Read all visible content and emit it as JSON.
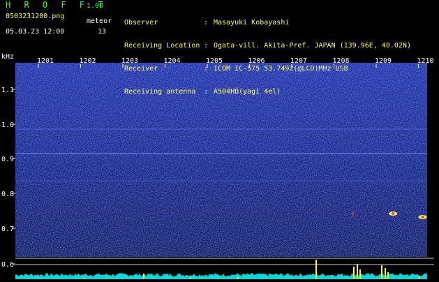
{
  "header": {
    "app_title": "H R O F F T",
    "app_version": "1.00",
    "file_name": "0503231200.png",
    "date_time": "05.03.23 12:00",
    "counter_label": "meteor",
    "counter_value": "13"
  },
  "station_info": [
    {
      "key": "Observer",
      "value": "Masayuki Kobayashi"
    },
    {
      "key": "Receiving Location",
      "value": "Ogata-vill. Akita-Pref. JAPAN (139.96E, 40.02N)"
    },
    {
      "key": "Receiver",
      "value": "ICOM IC-575 53.7492(@LCD)MHz USB"
    },
    {
      "key": "Receiving antenna",
      "value": "A504HB(yagi 4el)"
    }
  ],
  "spectrogram": {
    "y_unit": "kHz",
    "time_labels": [
      "1201",
      "1202",
      "1203",
      "1204",
      "1205",
      "1206",
      "1207",
      "1208",
      "1209",
      "1210"
    ],
    "freq_labels": [
      "1.1",
      "1.0",
      "0.9",
      "0.8",
      "0.7",
      "0.6"
    ],
    "freq_range_khz": [
      0.6,
      1.15
    ],
    "background_color": "#0a1460",
    "accent_color": "#33ff33",
    "activity_color": "#ffff00",
    "noise_color": "#00ffff",
    "meteor_events": [
      {
        "minute": 1208.4,
        "freq_khz": 0.75
      },
      {
        "minute": 1209.1,
        "freq_khz": 0.74
      },
      {
        "minute": 1207.45,
        "freq_khz": 0.75
      }
    ]
  }
}
